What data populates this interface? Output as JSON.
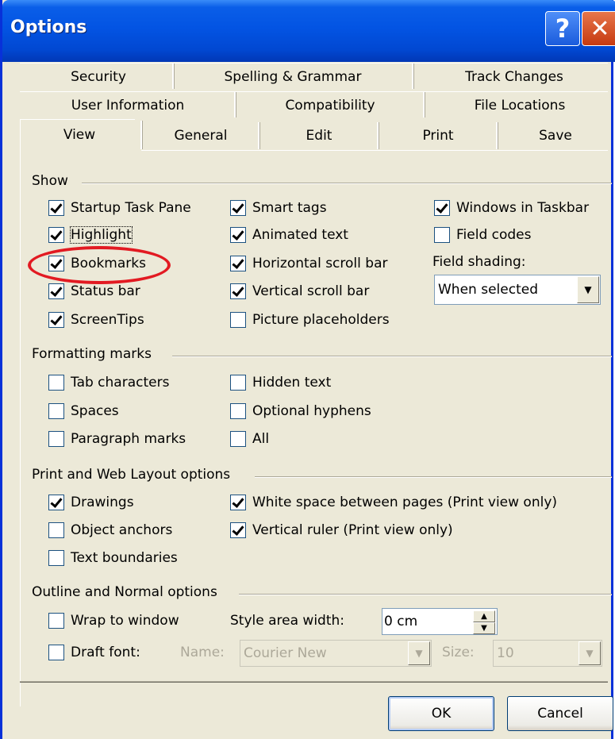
{
  "window": {
    "title": "Options",
    "help_glyph": "?",
    "close_glyph": "✕"
  },
  "tabs": {
    "row1": [
      "Security",
      "Spelling & Grammar",
      "Track Changes"
    ],
    "row2": [
      "User Information",
      "Compatibility",
      "File Locations"
    ],
    "row3": [
      "View",
      "General",
      "Edit",
      "Print",
      "Save"
    ],
    "active": "View"
  },
  "show": {
    "title": "Show",
    "col1": [
      {
        "label": "Startup Task Pane",
        "checked": true
      },
      {
        "label": "Highlight",
        "checked": true
      },
      {
        "label": "Bookmarks",
        "checked": true
      },
      {
        "label": "Status bar",
        "checked": true
      },
      {
        "label": "ScreenTips",
        "checked": true
      }
    ],
    "col2": [
      {
        "label": "Smart tags",
        "checked": true
      },
      {
        "label": "Animated text",
        "checked": true
      },
      {
        "label": "Horizontal scroll bar",
        "checked": true
      },
      {
        "label": "Vertical scroll bar",
        "checked": true
      },
      {
        "label": "Picture placeholders",
        "checked": false
      }
    ],
    "col3": [
      {
        "label": "Windows in Taskbar",
        "checked": true
      },
      {
        "label": "Field codes",
        "checked": false
      }
    ],
    "field_shading_label": "Field shading:",
    "field_shading_value": "When selected"
  },
  "formatting": {
    "title": "Formatting marks",
    "col1": [
      {
        "label": "Tab characters",
        "checked": false
      },
      {
        "label": "Spaces",
        "checked": false
      },
      {
        "label": "Paragraph marks",
        "checked": false
      }
    ],
    "col2": [
      {
        "label": "Hidden text",
        "checked": false
      },
      {
        "label": "Optional hyphens",
        "checked": false
      },
      {
        "label": "All",
        "checked": false
      }
    ]
  },
  "print_web": {
    "title": "Print and Web Layout options",
    "col1": [
      {
        "label": "Drawings",
        "checked": true
      },
      {
        "label": "Object anchors",
        "checked": false
      },
      {
        "label": "Text boundaries",
        "checked": false
      }
    ],
    "col2": [
      {
        "label": "White space between pages (Print view only)",
        "checked": true
      },
      {
        "label": "Vertical ruler (Print view only)",
        "checked": true
      }
    ]
  },
  "outline": {
    "title": "Outline and Normal options",
    "wrap_label": "Wrap to window",
    "wrap_checked": false,
    "style_area_label": "Style area width:",
    "style_area_value": "0 cm",
    "draft_label": "Draft font:",
    "draft_checked": false,
    "name_label": "Name:",
    "name_value": "Courier New",
    "size_label": "Size:",
    "size_value": "10"
  },
  "buttons": {
    "ok": "OK",
    "cancel": "Cancel"
  },
  "colors": {
    "highlight_ring": "#e21a22",
    "titlebar": "#0354e3"
  }
}
